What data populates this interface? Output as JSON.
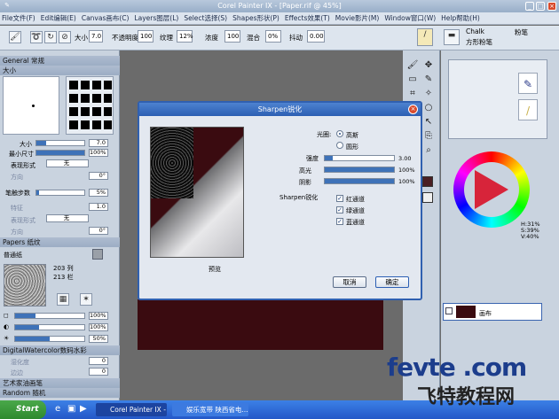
{
  "window": {
    "title": "Corel Painter IX - [Paper.rif @ 45%]"
  },
  "menu": [
    "File文件(F)",
    "Edit编辑(E)",
    "Canvas画布(C)",
    "Layers图层(L)",
    "Select选择(S)",
    "Shapes形状(P)",
    "Effects效果(T)",
    "Movie影片(M)",
    "Window窗口(W)",
    "Help帮助(H)"
  ],
  "toolbar": {
    "size_label": "大小",
    "size_value": "7.0",
    "opacity_label": "不透明度",
    "opacity_value": "100",
    "grain_label": "纹理",
    "grain_value": "12%",
    "resat_label": "浓度",
    "resat_value": "100",
    "bleed_label": "混合",
    "bleed_value": "0%",
    "jitter_label": "抖动",
    "jitter_value": "0.00",
    "brush_category": "Chalk",
    "brush_category_cn": "粉笔",
    "brush_variant": "方形粉笔"
  },
  "left_panel": {
    "general": "General 常规",
    "size_section": "大小",
    "size_label": "大小",
    "size_value": "7.0",
    "min_size_label": "最小尺寸",
    "min_size_value": "100%",
    "expression_label": "表现形式",
    "expression_value": "无",
    "direction_label": "方向",
    "direction_value": "0°",
    "brush_step_label": "笔触步数",
    "brush_step_value": "5%",
    "feature_label": "特征",
    "feature_value": "1.0",
    "expression2_label": "表现形式",
    "expression2_value": "无",
    "direction2_label": "方向",
    "direction2_value": "0°",
    "papers_section": "Papers 纸纹",
    "paper_name": "普通纸",
    "paper_cols": "203 列",
    "paper_rows": "213 栏",
    "paper_slider1": "100%",
    "paper_slider2": "100%",
    "paper_slider3": "50%",
    "digital_wc": "DigitalWatercolor数码水彩",
    "wet_label": "湿化度",
    "wet_value": "0",
    "edge_label": "边边",
    "edge_value": "0",
    "oil": "艺术家油画笔",
    "random": "Random 随机"
  },
  "dialog": {
    "title": "Sharpen锐化",
    "preview_label": "预览",
    "aperture_label": "光圈:",
    "aperture_options": [
      "高斯",
      "圆形"
    ],
    "aperture_selected": "高斯",
    "amount_label": "强度",
    "amount_value": "3.00",
    "highlight_label": "高光",
    "highlight_value": "100%",
    "shadow_label": "阴影",
    "shadow_value": "100%",
    "sharpen_label": "Sharpen锐化",
    "channels": [
      {
        "label": "红通道",
        "checked": true
      },
      {
        "label": "绿通道",
        "checked": true
      },
      {
        "label": "蓝通道",
        "checked": true
      }
    ],
    "cancel_label": "取消",
    "ok_label": "确定"
  },
  "right_panel": {
    "hsv": [
      "H:31%",
      "S:39%",
      "V:40%"
    ],
    "layer_name": "画布"
  },
  "taskbar": {
    "start": "Start",
    "tasks": [
      "Corel Painter IX - [Pap...",
      "娱乐宽带 陕西省电..."
    ]
  },
  "watermark": {
    "line1": "fevte .com",
    "line2": "飞特教程网"
  }
}
